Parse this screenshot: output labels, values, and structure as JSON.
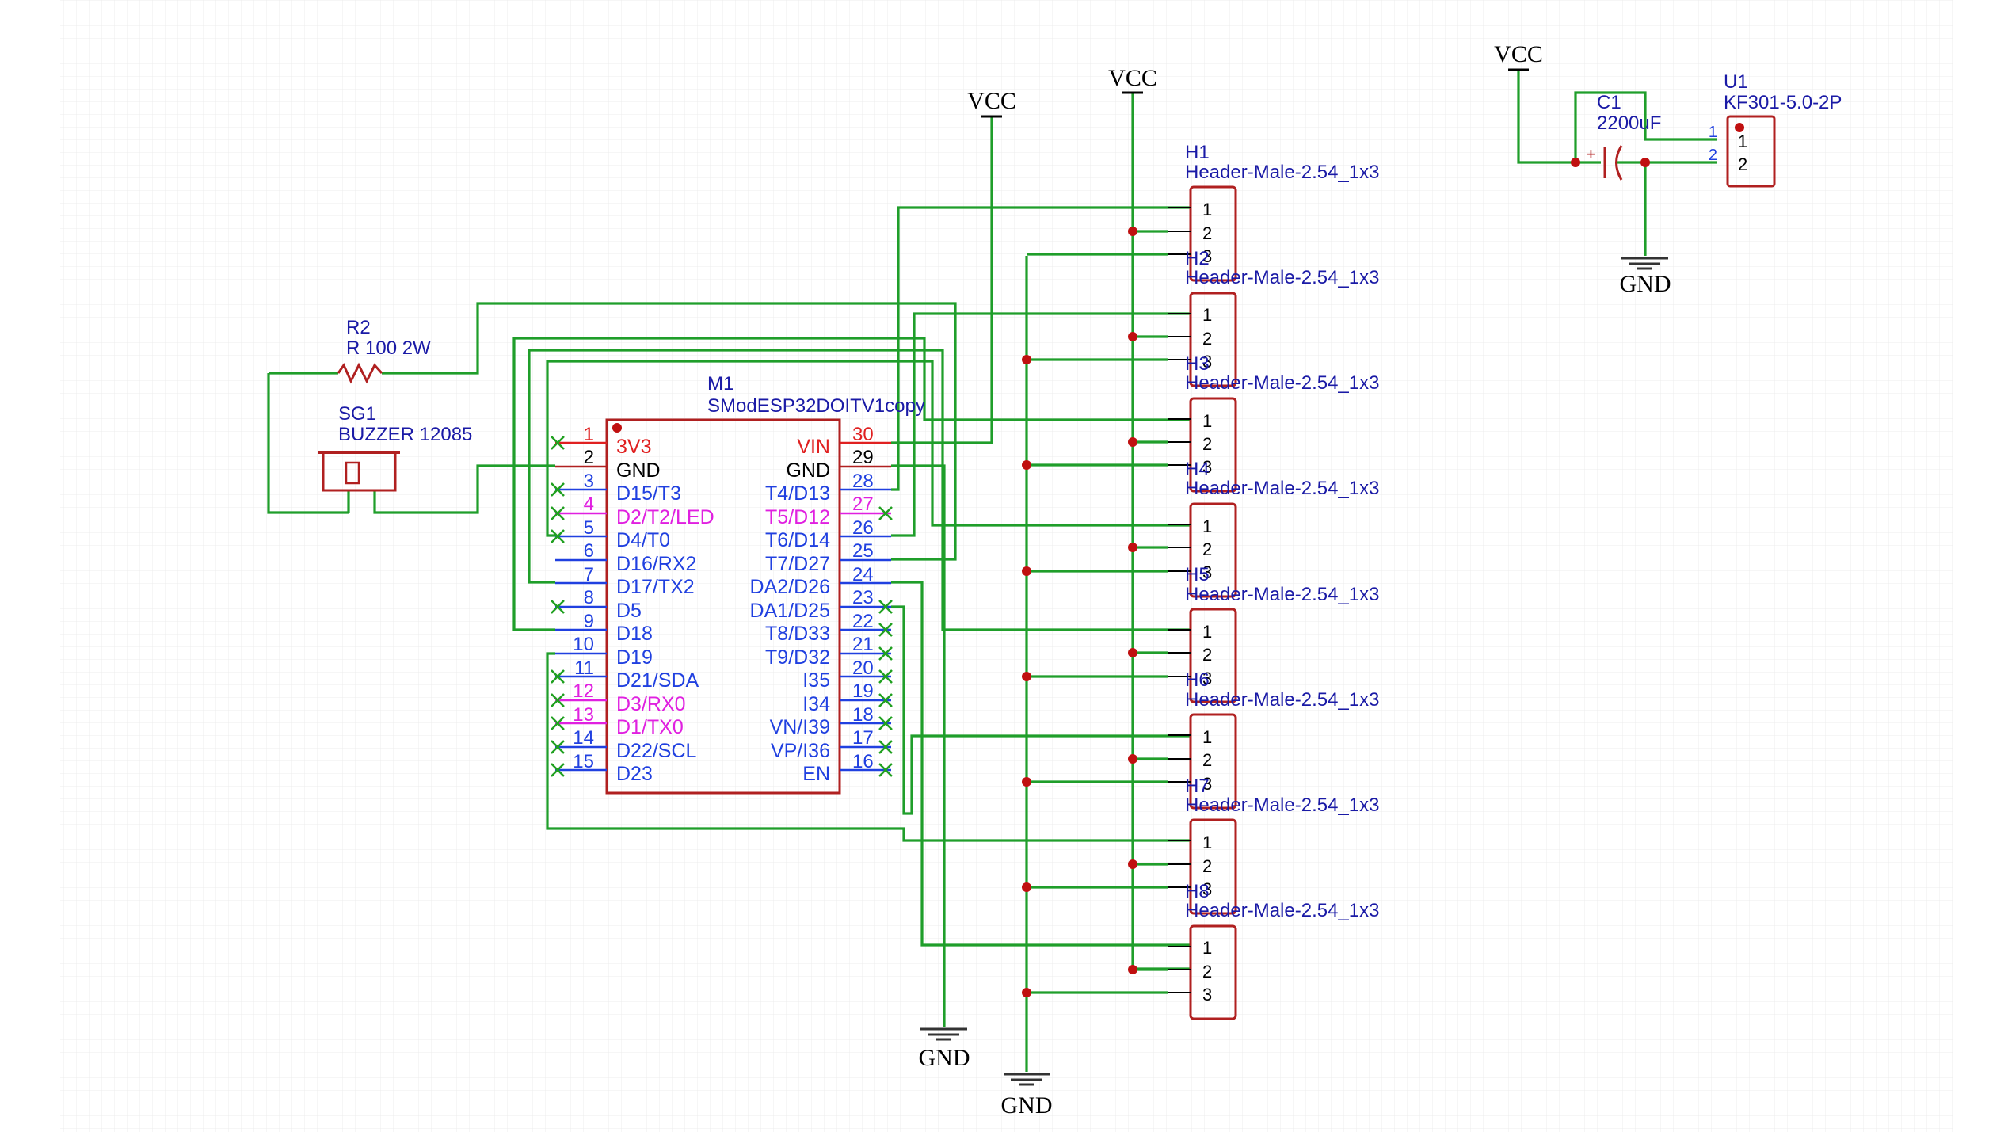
{
  "colors": {
    "wire": "#1f9e2a",
    "component": "#b02020",
    "label": "#1a1aa6",
    "pin_number": "#000000",
    "pin_red": "#e02020",
    "pin_magenta": "#e020e0",
    "pin_blue": "#2040e0",
    "noconnect": "#20a020",
    "junction": "#c01010",
    "grid": "#ececec"
  },
  "power": {
    "vcc_label": "VCC",
    "gnd_label": "GND"
  },
  "r2": {
    "ref": "R2",
    "value": "R 100 2W"
  },
  "sg1": {
    "ref": "SG1",
    "value": "BUZZER 12085"
  },
  "c1": {
    "ref": "C1",
    "value": "2200uF"
  },
  "u1": {
    "ref": "U1",
    "value": "KF301-5.0-2P",
    "pins": [
      "1",
      "2"
    ]
  },
  "m1": {
    "ref": "M1",
    "value": "SModESP32DOITV1copy",
    "left_pins": [
      {
        "num": "1",
        "name": "3V3",
        "color": "red"
      },
      {
        "num": "2",
        "name": "GND",
        "color": "black"
      },
      {
        "num": "3",
        "name": "D15/T3",
        "color": "blue"
      },
      {
        "num": "4",
        "name": "D2/T2/LED",
        "color": "magenta"
      },
      {
        "num": "5",
        "name": "D4/T0",
        "color": "blue"
      },
      {
        "num": "6",
        "name": "D16/RX2",
        "color": "blue"
      },
      {
        "num": "7",
        "name": "D17/TX2",
        "color": "blue"
      },
      {
        "num": "8",
        "name": "D5",
        "color": "blue"
      },
      {
        "num": "9",
        "name": "D18",
        "color": "blue"
      },
      {
        "num": "10",
        "name": "D19",
        "color": "blue"
      },
      {
        "num": "11",
        "name": "D21/SDA",
        "color": "blue"
      },
      {
        "num": "12",
        "name": "D3/RX0",
        "color": "magenta"
      },
      {
        "num": "13",
        "name": "D1/TX0",
        "color": "magenta"
      },
      {
        "num": "14",
        "name": "D22/SCL",
        "color": "blue"
      },
      {
        "num": "15",
        "name": "D23",
        "color": "blue"
      }
    ],
    "right_pins": [
      {
        "num": "30",
        "name": "VIN",
        "color": "red"
      },
      {
        "num": "29",
        "name": "GND",
        "color": "black"
      },
      {
        "num": "28",
        "name": "T4/D13",
        "color": "blue"
      },
      {
        "num": "27",
        "name": "T5/D12",
        "color": "magenta"
      },
      {
        "num": "26",
        "name": "T6/D14",
        "color": "blue"
      },
      {
        "num": "25",
        "name": "T7/D27",
        "color": "blue"
      },
      {
        "num": "24",
        "name": "DA2/D26",
        "color": "blue"
      },
      {
        "num": "23",
        "name": "DA1/D25",
        "color": "blue"
      },
      {
        "num": "22",
        "name": "T8/D33",
        "color": "blue"
      },
      {
        "num": "21",
        "name": "T9/D32",
        "color": "blue"
      },
      {
        "num": "20",
        "name": "I35",
        "color": "blue"
      },
      {
        "num": "19",
        "name": "I34",
        "color": "blue"
      },
      {
        "num": "18",
        "name": "VN/I39",
        "color": "blue"
      },
      {
        "num": "17",
        "name": "VP/I36",
        "color": "blue"
      },
      {
        "num": "16",
        "name": "EN",
        "color": "blue"
      }
    ]
  },
  "headers": [
    {
      "ref": "H1",
      "value": "Header-Male-2.54_1x3",
      "pins": [
        "1",
        "2",
        "3"
      ]
    },
    {
      "ref": "H2",
      "value": "Header-Male-2.54_1x3",
      "pins": [
        "1",
        "2",
        "3"
      ]
    },
    {
      "ref": "H3",
      "value": "Header-Male-2.54_1x3",
      "pins": [
        "1",
        "2",
        "3"
      ]
    },
    {
      "ref": "H4",
      "value": "Header-Male-2.54_1x3",
      "pins": [
        "1",
        "2",
        "3"
      ]
    },
    {
      "ref": "H5",
      "value": "Header-Male-2.54_1x3",
      "pins": [
        "1",
        "2",
        "3"
      ]
    },
    {
      "ref": "H6",
      "value": "Header-Male-2.54_1x3",
      "pins": [
        "1",
        "2",
        "3"
      ]
    },
    {
      "ref": "H7",
      "value": "Header-Male-2.54_1x3",
      "pins": [
        "1",
        "2",
        "3"
      ]
    },
    {
      "ref": "H8",
      "value": "Header-Male-2.54_1x3",
      "pins": [
        "1",
        "2",
        "3"
      ]
    }
  ]
}
